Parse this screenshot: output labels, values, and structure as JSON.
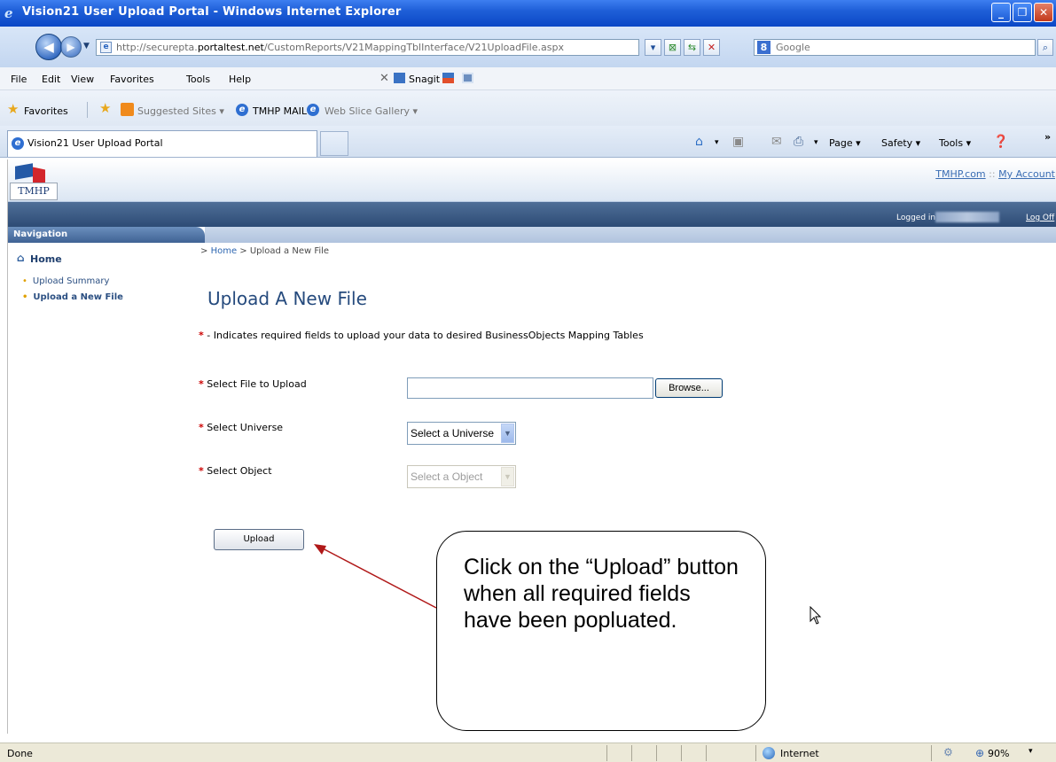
{
  "window": {
    "title": "Vision21 User Upload Portal - Windows Internet Explorer",
    "buttons": [
      "_",
      "❐",
      "✕"
    ]
  },
  "address": {
    "url_prefix": "http://securepta.",
    "url_domain": "portaltest.net",
    "url_path": "/CustomReports/V21MappingTblInterface/V21UploadFile.aspx",
    "search_placeholder": "Google"
  },
  "menu": {
    "items": [
      "File",
      "Edit",
      "View",
      "Favorites",
      "Tools",
      "Help"
    ],
    "snagit": "Snagit"
  },
  "favorites": {
    "label": "Favorites",
    "items": [
      "Suggested Sites ▾",
      "TMHP MAIL",
      "Web Slice Gallery ▾"
    ]
  },
  "tab": {
    "title": "Vision21 User Upload Portal"
  },
  "commands": {
    "page": "Page ▾",
    "safety": "Safety ▾",
    "tools": "Tools ▾",
    "more": "»"
  },
  "site": {
    "logo_text": "TMHP",
    "link_home": "TMHP.com",
    "link_separator": "::",
    "link_account": "My Account",
    "logged_in_label": "Logged in as:",
    "log_off": "Log Off",
    "nav_header": "Navigation",
    "nav_home": "Home",
    "nav_items": [
      "Upload Summary",
      "Upload a New File"
    ]
  },
  "main": {
    "breadcrumb_prefix": "> ",
    "breadcrumb_home": "Home",
    "breadcrumb_rest": " > Upload a New File",
    "heading": "Upload A New File",
    "required_note": " - Indicates required fields to upload your data to desired BusinessObjects Mapping Tables",
    "required_mark": "*",
    "fields": {
      "file_label": "Select File to Upload",
      "browse": "Browse...",
      "universe_label": "Select Universe",
      "universe_value": "Select a Universe",
      "object_label": "Select Object",
      "object_value": "Select a Object"
    },
    "upload_button": "Upload"
  },
  "callout": {
    "text": "Click on the “Upload” button when all required fields have been popluated."
  },
  "status": {
    "left": "Done",
    "zone": "Internet",
    "zoom": "90%"
  }
}
